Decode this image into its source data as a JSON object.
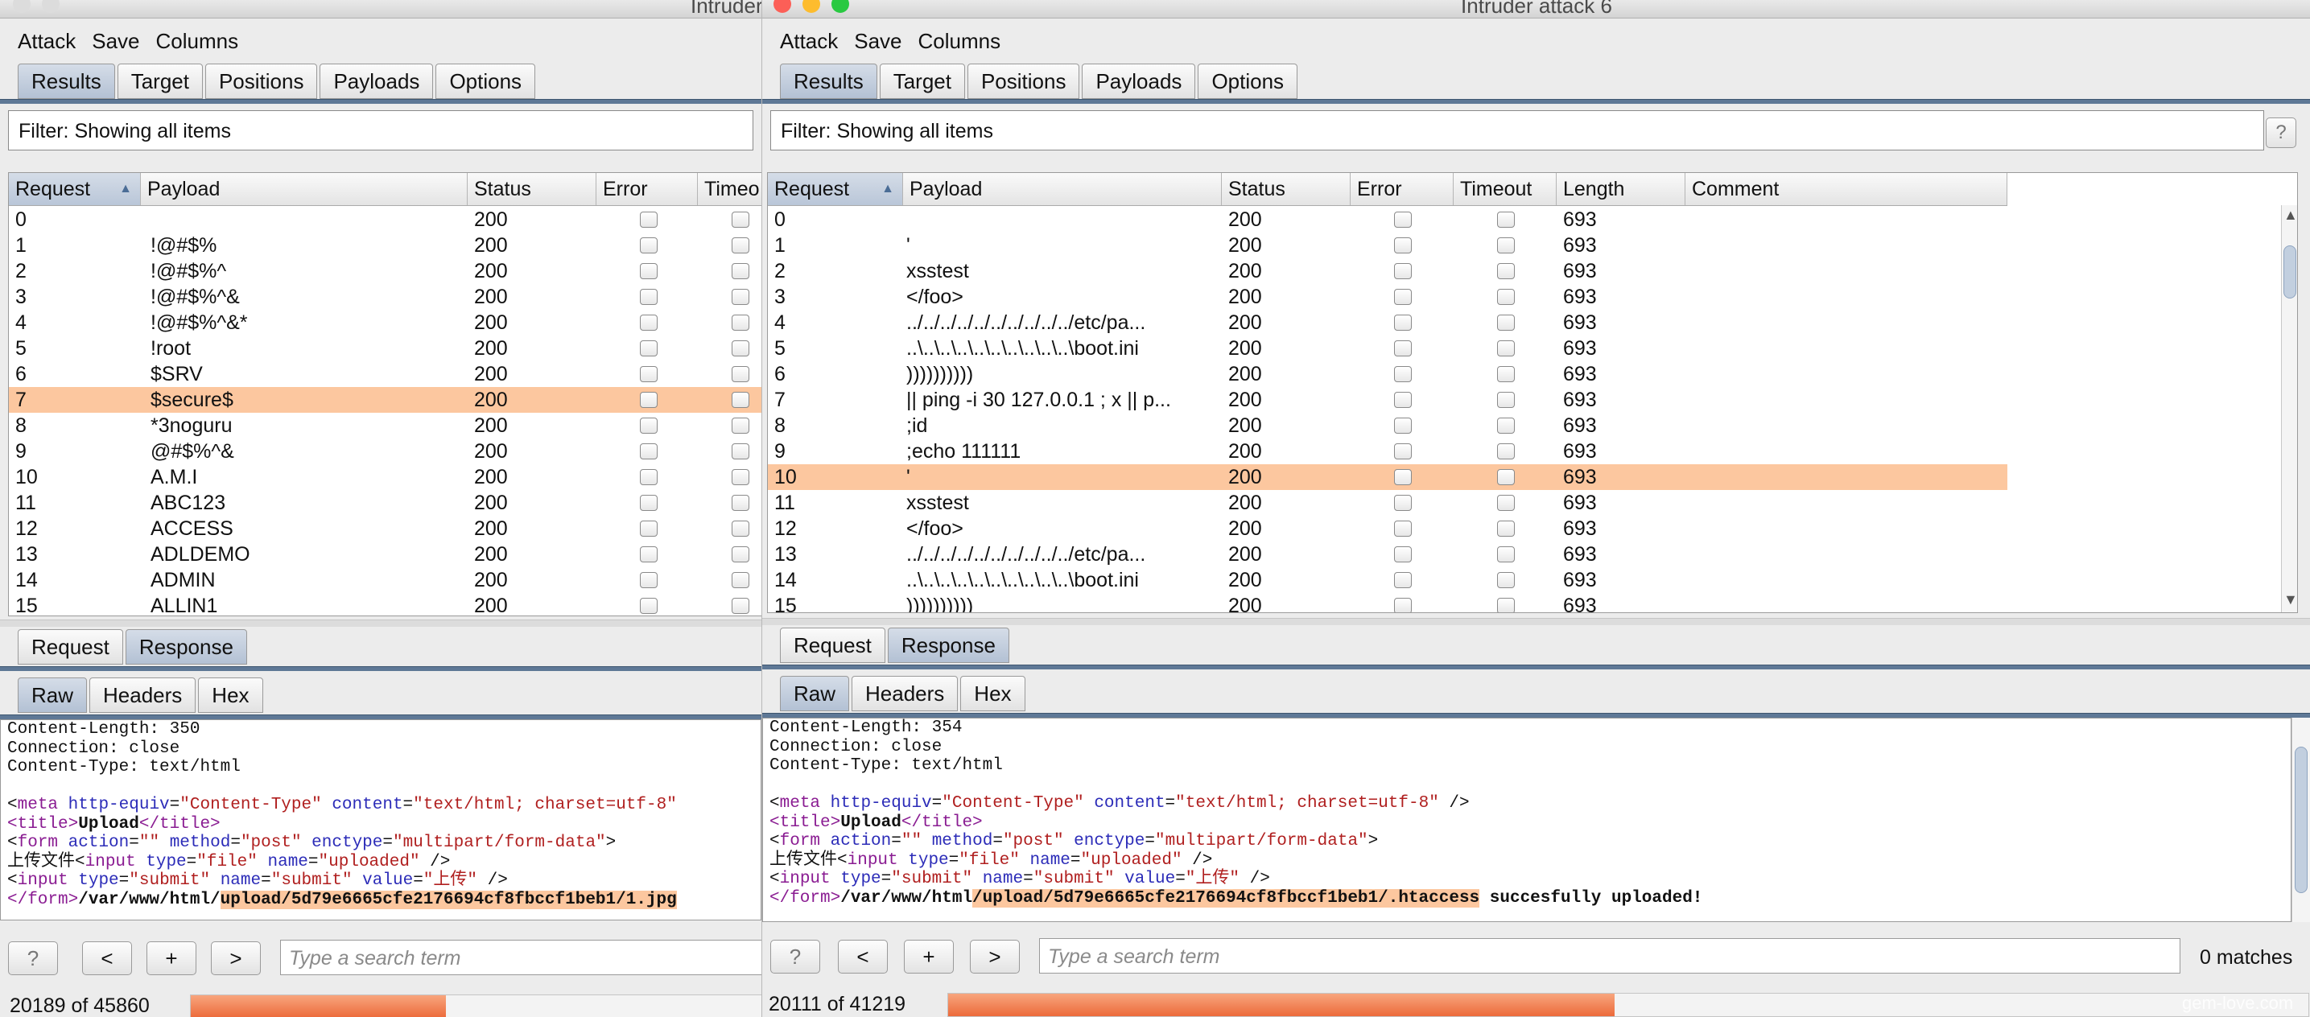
{
  "left": {
    "title": "Intruder",
    "menu": [
      "Attack",
      "Save",
      "Columns"
    ],
    "tabs": [
      "Results",
      "Target",
      "Positions",
      "Payloads",
      "Options"
    ],
    "filter": "Filter: Showing all items",
    "columns": [
      "Request",
      "Payload",
      "Status",
      "Error",
      "Timeo"
    ],
    "rows": [
      {
        "request": "0",
        "payload": "",
        "status": "200"
      },
      {
        "request": "1",
        "payload": "!@#$%",
        "status": "200"
      },
      {
        "request": "2",
        "payload": "!@#$%^",
        "status": "200"
      },
      {
        "request": "3",
        "payload": "!@#$%^&",
        "status": "200"
      },
      {
        "request": "4",
        "payload": "!@#$%^&*",
        "status": "200"
      },
      {
        "request": "5",
        "payload": "!root",
        "status": "200"
      },
      {
        "request": "6",
        "payload": "$SRV",
        "status": "200"
      },
      {
        "request": "7",
        "payload": "$secure$",
        "status": "200"
      },
      {
        "request": "8",
        "payload": "*3noguru",
        "status": "200"
      },
      {
        "request": "9",
        "payload": "@#$%^&",
        "status": "200"
      },
      {
        "request": "10",
        "payload": "A.M.I",
        "status": "200"
      },
      {
        "request": "11",
        "payload": "ABC123",
        "status": "200"
      },
      {
        "request": "12",
        "payload": "ACCESS",
        "status": "200"
      },
      {
        "request": "13",
        "payload": "ADLDEMO",
        "status": "200"
      },
      {
        "request": "14",
        "payload": "ADMIN",
        "status": "200"
      },
      {
        "request": "15",
        "payload": "ALLIN1",
        "status": "200"
      }
    ],
    "selected_row": 7,
    "reqresp_tabs": [
      "Request",
      "Response"
    ],
    "view_tabs": [
      "Raw",
      "Headers",
      "Hex"
    ],
    "response": {
      "l1": "Content-Length: 350",
      "l2": "Connection: close",
      "l3": "Content-Type: text/html",
      "meta_attr_val": "\"text/html; charset=utf-8\"",
      "path": "/var/www/html/",
      "uploaded": "upload/5d79e6665cfe2176694cf8fbccf1beb1/1.jpg"
    },
    "nav": {
      "help": "?",
      "prev": "<",
      "add": "+",
      "next": ">"
    },
    "search_placeholder": "Type a search term",
    "progress_text": "20189 of 45860",
    "progress_value": 0.44
  },
  "right": {
    "title": "Intruder attack 6",
    "menu": [
      "Attack",
      "Save",
      "Columns"
    ],
    "tabs": [
      "Results",
      "Target",
      "Positions",
      "Payloads",
      "Options"
    ],
    "filter": "Filter: Showing all items",
    "help": "?",
    "columns": [
      "Request",
      "Payload",
      "Status",
      "Error",
      "Timeout",
      "Length",
      "Comment"
    ],
    "rows": [
      {
        "request": "0",
        "payload": "",
        "status": "200",
        "length": "693"
      },
      {
        "request": "1",
        "payload": "'",
        "status": "200",
        "length": "693"
      },
      {
        "request": "2",
        "payload": "xsstest",
        "status": "200",
        "length": "693"
      },
      {
        "request": "3",
        "payload": "</foo>",
        "status": "200",
        "length": "693"
      },
      {
        "request": "4",
        "payload": "../../../../../../../../../../etc/pa...",
        "status": "200",
        "length": "693"
      },
      {
        "request": "5",
        "payload": "..\\..\\..\\..\\..\\..\\..\\..\\..\\..\\boot.ini",
        "status": "200",
        "length": "693"
      },
      {
        "request": "6",
        "payload": "))))))))))",
        "status": "200",
        "length": "693"
      },
      {
        "request": "7",
        "payload": "|| ping -i 30 127.0.0.1 ; x || p...",
        "status": "200",
        "length": "693"
      },
      {
        "request": "8",
        "payload": ";id",
        "status": "200",
        "length": "693"
      },
      {
        "request": "9",
        "payload": ";echo 111111",
        "status": "200",
        "length": "693"
      },
      {
        "request": "10",
        "payload": "'",
        "status": "200",
        "length": "693"
      },
      {
        "request": "11",
        "payload": "xsstest",
        "status": "200",
        "length": "693"
      },
      {
        "request": "12",
        "payload": "</foo>",
        "status": "200",
        "length": "693"
      },
      {
        "request": "13",
        "payload": "../../../../../../../../../../etc/pa...",
        "status": "200",
        "length": "693"
      },
      {
        "request": "14",
        "payload": "..\\..\\..\\..\\..\\..\\..\\..\\..\\..\\boot.ini",
        "status": "200",
        "length": "693"
      },
      {
        "request": "15",
        "payload": "))))))))))",
        "status": "200",
        "length": "693"
      }
    ],
    "selected_row": 10,
    "reqresp_tabs": [
      "Request",
      "Response"
    ],
    "view_tabs": [
      "Raw",
      "Headers",
      "Hex"
    ],
    "response": {
      "l1": "Content-Length: 354",
      "l2": "Connection: close",
      "l3": "Content-Type: text/html",
      "meta_attr_val": "\"text/html; charset=utf-8\"",
      "path": "/var/www/html",
      "uploaded": "/upload/5d79e6665cfe2176694cf8fbccf1beb1/.htaccess",
      "suffix": " succesfully uploaded!"
    },
    "nav": {
      "help": "?",
      "prev": "<",
      "add": "+",
      "next": ">"
    },
    "search_placeholder": "Type a search term",
    "matches": "0 matches",
    "progress_text": "20111 of 41219",
    "progress_value": 0.49
  },
  "html_snippet": {
    "meta_tag": "meta",
    "http_equiv_attr": "http-equiv",
    "http_equiv_val": "\"Content-Type\"",
    "content_attr": "content",
    "title_open": "<title>",
    "title_text": "Upload",
    "title_close": "</title>",
    "form_open": "form",
    "action_attr": "action",
    "action_val": "\"\"",
    "method_attr": "method",
    "method_val": "\"post\"",
    "enctype_attr": "enctype",
    "enctype_val": "\"multipart/form-data\"",
    "upload_label": "上传文件",
    "input_tag": "input",
    "type_attr": "type",
    "file_val": "\"file\"",
    "name_attr": "name",
    "uploaded_val": "\"uploaded\"",
    "submit_val": "\"submit\"",
    "value_attr": "value",
    "submit_label_val": "\"上传\"",
    "form_close": "</form>",
    "self_close": " />"
  },
  "watermark": "gem-love.com",
  "colors": {
    "selection": "#fcc79f",
    "progress": "#ec6a3a",
    "tab_active": "#b3c1d4"
  }
}
